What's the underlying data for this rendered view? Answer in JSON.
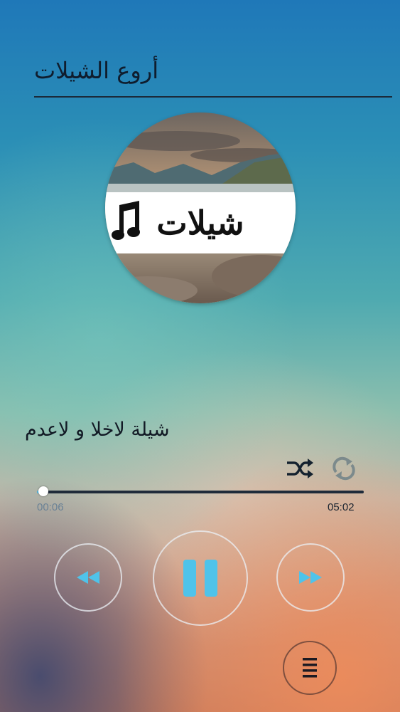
{
  "header": {
    "title": "أروع الشيلات"
  },
  "album": {
    "label": "شيلات"
  },
  "track": {
    "title": "شيلة لاخلا و لاعدم"
  },
  "playback": {
    "elapsed": "00:06",
    "total": "05:02",
    "progress_fraction": 0.02,
    "state": "playing"
  },
  "icons": {
    "shuffle": "shuffle-icon",
    "repeat": "repeat-icon",
    "rewind": "rewind-icon",
    "pause": "pause-icon",
    "forward": "fast-forward-icon",
    "menu": "menu-icon",
    "music": "music-note-icon"
  },
  "colors": {
    "accent": "#4fc3ea",
    "title_text": "#0f1d2e",
    "seek_track": "#1f2b3a"
  }
}
